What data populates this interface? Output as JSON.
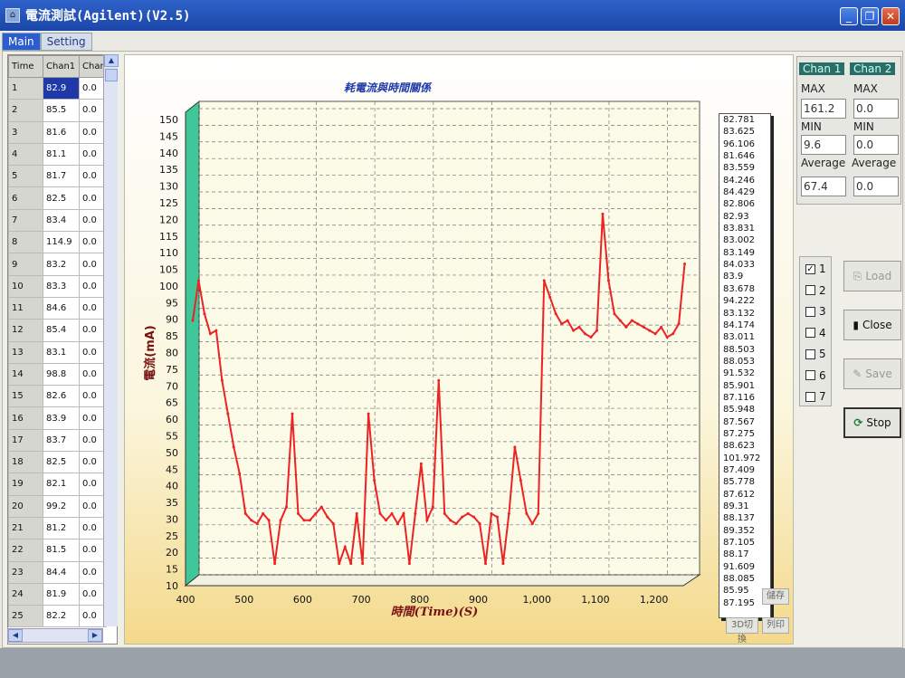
{
  "window": {
    "title": "電流測試(Agilent)(V2.5)",
    "icon": "app-icon"
  },
  "tabs": [
    {
      "label": "Main",
      "active": true
    },
    {
      "label": "Setting",
      "active": false
    }
  ],
  "grid": {
    "columns": [
      "Time",
      "Chan1",
      "Chan"
    ],
    "rows": [
      [
        "1",
        "82.9",
        "0.0"
      ],
      [
        "2",
        "85.5",
        "0.0"
      ],
      [
        "3",
        "81.6",
        "0.0"
      ],
      [
        "4",
        "81.1",
        "0.0"
      ],
      [
        "5",
        "81.7",
        "0.0"
      ],
      [
        "6",
        "82.5",
        "0.0"
      ],
      [
        "7",
        "83.4",
        "0.0"
      ],
      [
        "8",
        "114.9",
        "0.0"
      ],
      [
        "9",
        "83.2",
        "0.0"
      ],
      [
        "10",
        "83.3",
        "0.0"
      ],
      [
        "11",
        "84.6",
        "0.0"
      ],
      [
        "12",
        "85.4",
        "0.0"
      ],
      [
        "13",
        "83.1",
        "0.0"
      ],
      [
        "14",
        "98.8",
        "0.0"
      ],
      [
        "15",
        "82.6",
        "0.0"
      ],
      [
        "16",
        "83.9",
        "0.0"
      ],
      [
        "17",
        "83.7",
        "0.0"
      ],
      [
        "18",
        "82.5",
        "0.0"
      ],
      [
        "19",
        "82.1",
        "0.0"
      ],
      [
        "20",
        "99.2",
        "0.0"
      ],
      [
        "21",
        "81.2",
        "0.0"
      ],
      [
        "22",
        "81.5",
        "0.0"
      ],
      [
        "23",
        "84.4",
        "0.0"
      ],
      [
        "24",
        "81.9",
        "0.0"
      ],
      [
        "25",
        "82.2",
        "0.0"
      ]
    ]
  },
  "chart_data": {
    "type": "line",
    "title": "耗電流與時間關係",
    "xlabel": "時間(Time)(S)",
    "ylabel": "電流(mA)",
    "xlim": [
      400,
      1250
    ],
    "ylim": [
      10,
      150
    ],
    "x_ticks": [
      "400",
      "500",
      "600",
      "700",
      "800",
      "900",
      "1,000",
      "1,100",
      "1,200"
    ],
    "y_ticks": [
      "10",
      "15",
      "20",
      "25",
      "30",
      "35",
      "40",
      "45",
      "50",
      "55",
      "60",
      "65",
      "70",
      "75",
      "80",
      "85",
      "90",
      "95",
      "100",
      "105",
      "110",
      "115",
      "120",
      "125",
      "130",
      "135",
      "140",
      "145",
      "150"
    ],
    "grid": true,
    "series_color": "#ee2222",
    "series": [
      {
        "x": [
          400,
          410,
          420,
          430,
          440,
          450,
          460,
          470,
          480,
          490,
          500,
          510,
          520,
          530,
          540,
          550,
          560,
          570,
          580,
          590,
          600,
          610,
          620,
          630,
          640,
          650,
          660,
          670,
          680,
          690,
          700,
          710,
          720,
          730,
          740,
          750,
          760,
          770,
          780,
          790,
          800,
          810,
          820,
          830,
          840,
          850,
          860,
          870,
          880,
          890,
          900,
          910,
          920,
          930,
          940,
          950,
          960,
          970,
          980,
          990,
          1000,
          1010,
          1020,
          1030,
          1040,
          1050,
          1060,
          1070,
          1080,
          1090,
          1100,
          1110,
          1120,
          1130,
          1140,
          1150,
          1160,
          1170,
          1180,
          1190,
          1200,
          1210,
          1220,
          1230,
          1240
        ],
        "values": [
          88,
          100,
          90,
          84,
          85,
          70,
          60,
          50,
          42,
          30,
          28,
          27,
          30,
          28,
          15,
          28,
          32,
          60,
          30,
          28,
          28,
          30,
          32,
          29,
          27,
          15,
          20,
          15,
          30,
          15,
          60,
          40,
          30,
          28,
          30,
          27,
          30,
          15,
          30,
          45,
          28,
          32,
          70,
          30,
          28,
          27,
          29,
          30,
          29,
          27,
          15,
          30,
          29,
          15,
          30,
          50,
          40,
          30,
          27,
          30,
          100,
          95,
          90,
          87,
          88,
          85,
          86,
          84,
          83,
          85,
          120,
          100,
          90,
          88,
          86,
          88,
          87,
          86,
          85,
          84,
          86,
          83,
          84,
          87,
          105
        ]
      }
    ]
  },
  "legend": {
    "values": [
      "82.781",
      "83.625",
      "96.106",
      "81.646",
      "83.559",
      "84.246",
      "84.429",
      "82.806",
      "82.93",
      "83.831",
      "83.002",
      "83.149",
      "84.033",
      "83.9",
      "83.678",
      "94.222",
      "83.132",
      "84.174",
      "83.011",
      "88.503",
      "88.053",
      "91.532",
      "85.901",
      "87.116",
      "85.948",
      "87.567",
      "87.275",
      "88.623",
      "101.972",
      "87.409",
      "85.778",
      "87.612",
      "89.31",
      "88.137",
      "89.352",
      "87.105",
      "88.17",
      "91.609",
      "88.085",
      "85.95",
      "87.195"
    ]
  },
  "chart_buttons": {
    "save": "儲存",
    "view3d": "3D切換",
    "print": "列印"
  },
  "stats": {
    "chan1": "Chan 1",
    "chan2": "Chan 2",
    "max_label": "MAX",
    "min_label": "MIN",
    "avg_label": "Average",
    "chan1_max": "161.2",
    "chan2_max": "0.0",
    "chan1_min": "9.6",
    "chan2_min": "0.0",
    "chan1_avg": "67.4",
    "chan2_avg": "0.0"
  },
  "channels": [
    {
      "label": "1",
      "checked": true
    },
    {
      "label": "2",
      "checked": false
    },
    {
      "label": "3",
      "checked": false
    },
    {
      "label": "4",
      "checked": false
    },
    {
      "label": "5",
      "checked": false
    },
    {
      "label": "6",
      "checked": false
    },
    {
      "label": "7",
      "checked": false
    }
  ],
  "buttons": {
    "load": "Load",
    "close": "Close",
    "save": "Save",
    "stop": "Stop"
  }
}
